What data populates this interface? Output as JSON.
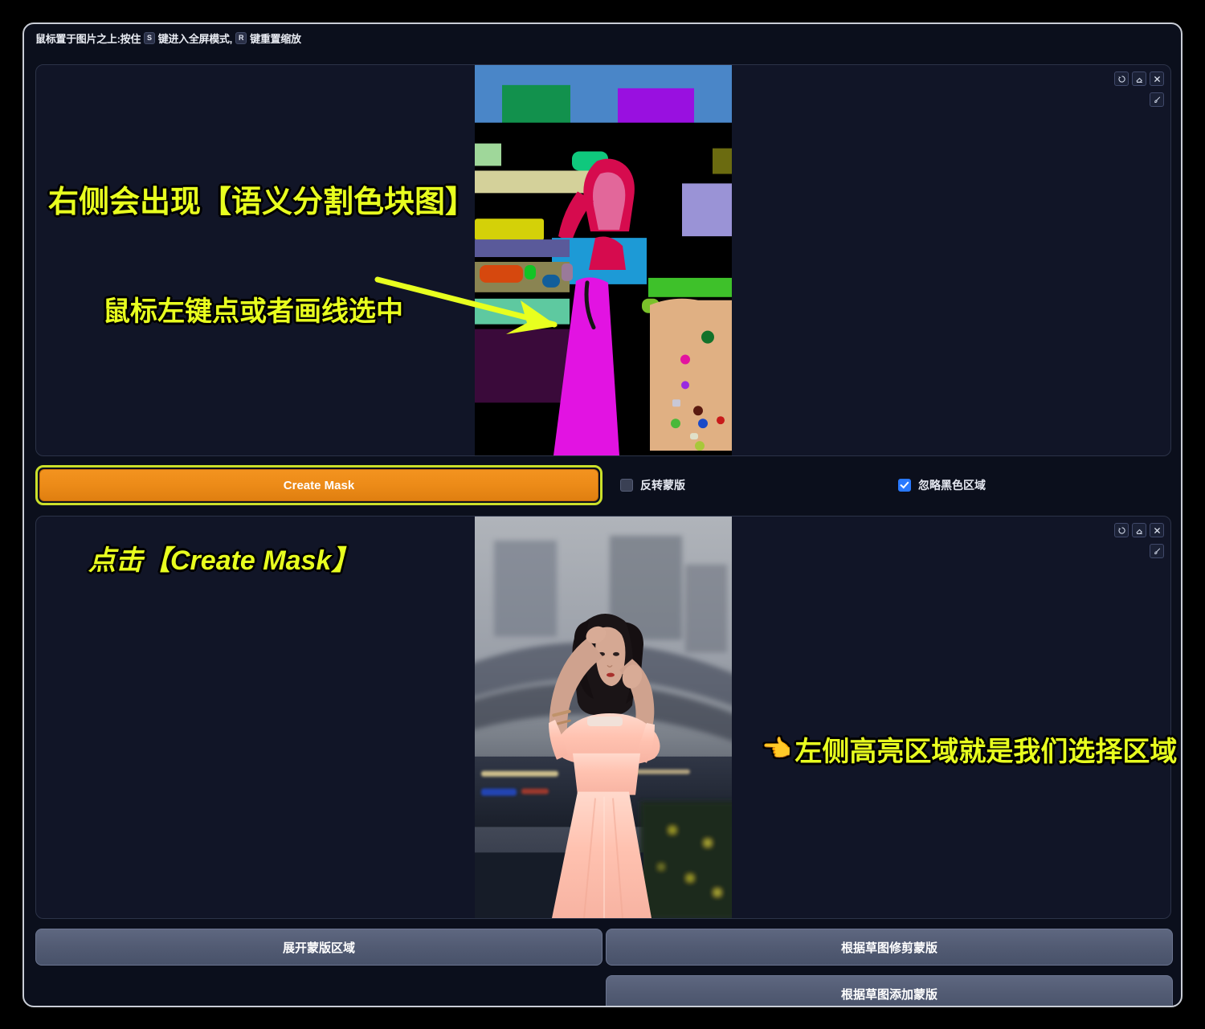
{
  "hint": {
    "prefix": "鼠标置于图片之上:按住",
    "key_s": "S",
    "mid": "键进入全屏模式,",
    "key_r": "R",
    "suffix": "键重置缩放"
  },
  "tools": [
    {
      "name": "reset-zoom-icon",
      "title": "重置缩放"
    },
    {
      "name": "eraser-icon",
      "title": "橡皮擦"
    },
    {
      "name": "close-icon",
      "title": "关闭"
    },
    {
      "name": "brush-icon",
      "title": "画笔"
    }
  ],
  "actions": {
    "create_mask_label": "Create Mask",
    "invert_mask_label": "反转蒙版",
    "invert_mask_checked": false,
    "ignore_black_label": "忽略黑色区域",
    "ignore_black_checked": true
  },
  "bottom_buttons": {
    "expand_label": "展开蒙版区域",
    "trim_label": "根据草图修剪蒙版",
    "add_label": "根据草图添加蒙版"
  },
  "annotations": {
    "segmentation": "右侧会出现【语义分割色块图】",
    "click_select": "鼠标左键点或者画线选中",
    "click_button": "点击【Create Mask】",
    "right_hand": "👈",
    "right_text": "左侧高亮区域就是我们选择区域"
  },
  "colors": {
    "accent_button": "#ec8b18",
    "highlight_outline": "#cbe02a",
    "annotation_text": "#e8ff1f",
    "checkbox_checked": "#2979ff",
    "panel_bg": "#111527",
    "app_bg": "#0b0f1c"
  },
  "segmentation_palette": {
    "sky": "#4a86c8",
    "building_green": "#12914d",
    "building_purple": "#9910e0",
    "wall_lightgreen": "#9fd79a",
    "band_khaki": "#d4d19a",
    "band_yellow": "#d4d108",
    "teal_blob": "#0fc87d",
    "hair_crimson": "#d60b4e",
    "skin_pink": "#e2679a",
    "torso_blue": "#1d9ad6",
    "dress_magenta": "#e213e2",
    "ground_tan": "#e0b083",
    "lilac": "#9a93d6",
    "olive": "#6b6b10",
    "slate_violet": "#5a5a9a",
    "orange_blob": "#d6480e",
    "mint_band": "#5ec9a0",
    "deep_purple": "#3a0a3a",
    "black": "#000000"
  }
}
